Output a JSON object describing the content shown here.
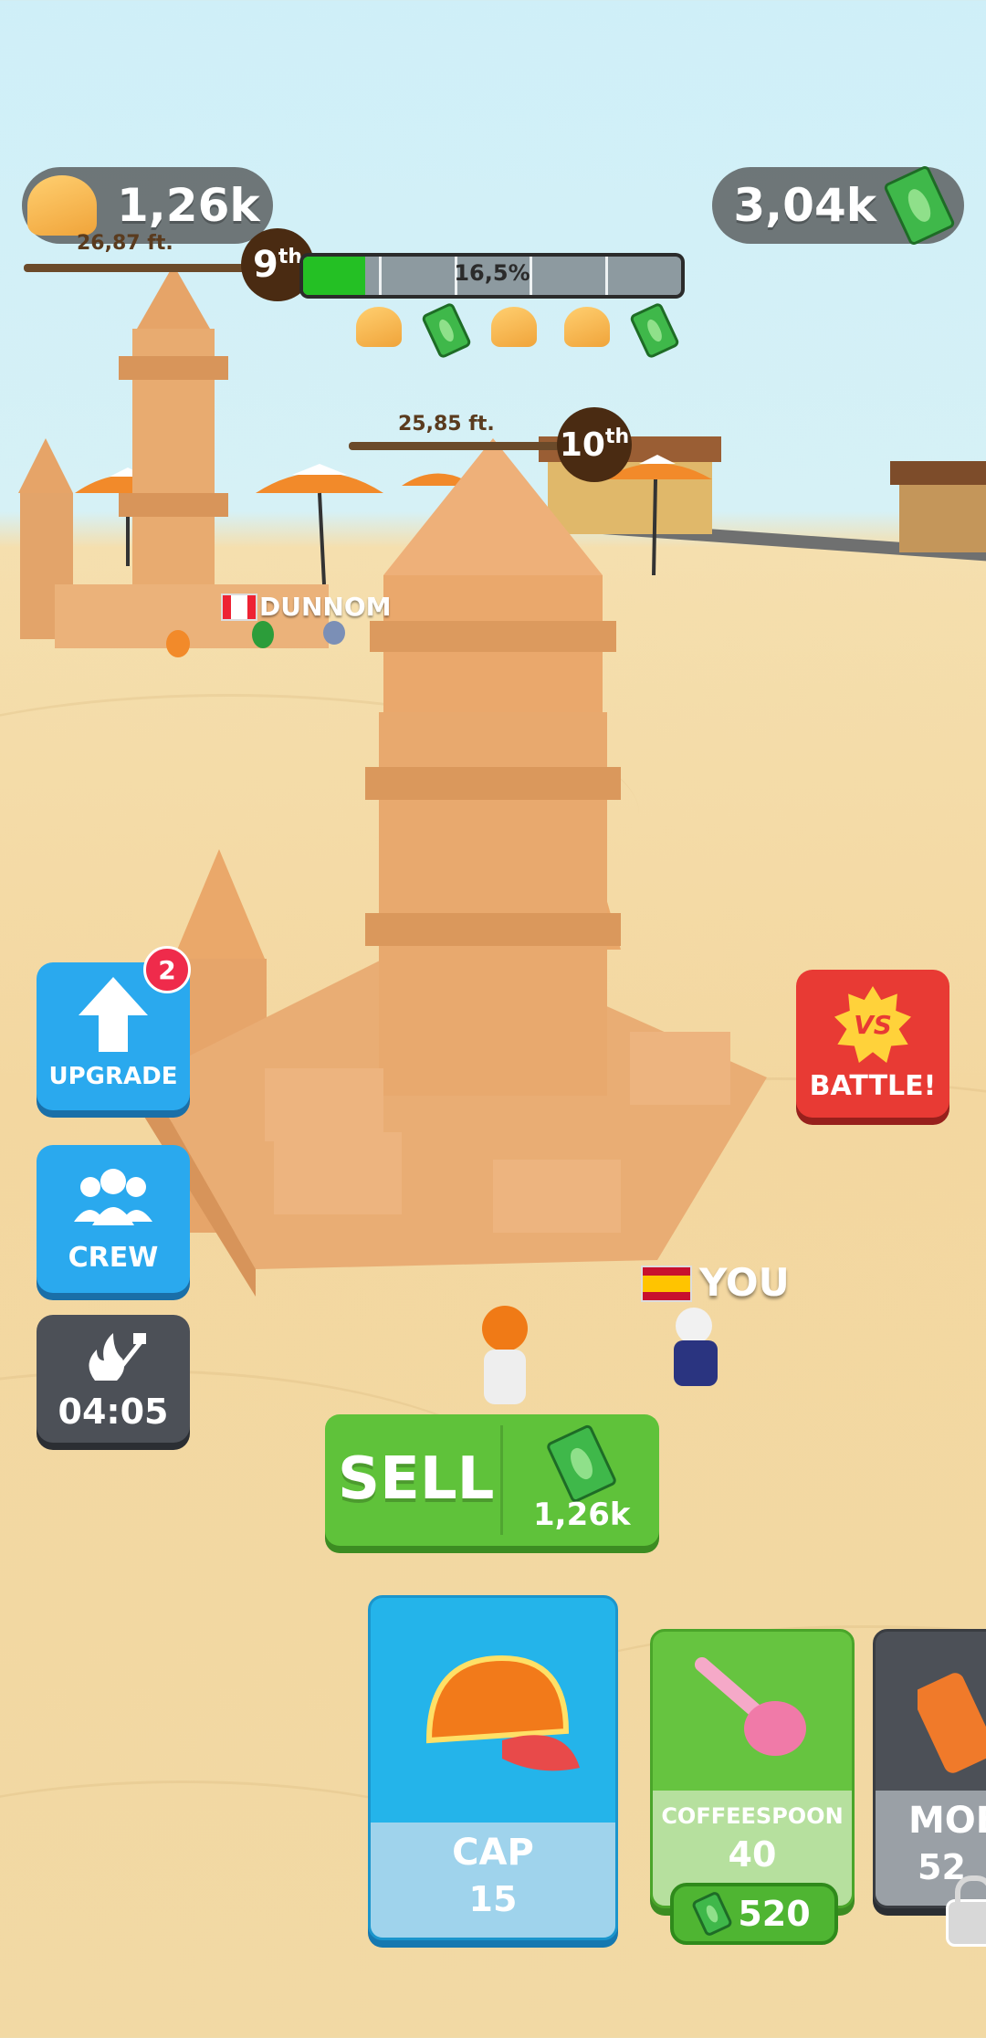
{
  "hud": {
    "sand_amount": "1,26k",
    "cash_amount": "3,04k",
    "my_height": "26,87 ft.",
    "my_rank_num": "9",
    "my_rank_suffix": "th",
    "progress_label": "16,5%",
    "progress_fraction": 0.165,
    "rewards": [
      "sand-icon",
      "money-icon",
      "sand-icon",
      "sand-icon",
      "money-icon"
    ]
  },
  "world": {
    "rival_height": "25,85 ft.",
    "rival_rank_num": "10",
    "rival_rank_suffix": "th",
    "rival_name": "DUNNOM",
    "player_name": "YOU"
  },
  "side_buttons": {
    "upgrade_label": "UPGRADE",
    "upgrade_badge": "2",
    "crew_label": "CREW",
    "timer": "04:05",
    "battle_label": "BATTLE!",
    "battle_vs": "VS"
  },
  "sell": {
    "label": "SELL",
    "amount": "1,26k"
  },
  "shop": {
    "items": [
      {
        "name": "CAP",
        "value": "15"
      },
      {
        "name": "COFFEESPOON",
        "value": "40",
        "price": "520"
      },
      {
        "name": "MOB",
        "value": "52"
      }
    ]
  },
  "colors": {
    "sky": "#cfeff8",
    "sand": "#f3d7a0",
    "upgrade_blue": "#2aa9ee",
    "sell_green": "#5fc23a",
    "battle_red": "#e83a34"
  }
}
